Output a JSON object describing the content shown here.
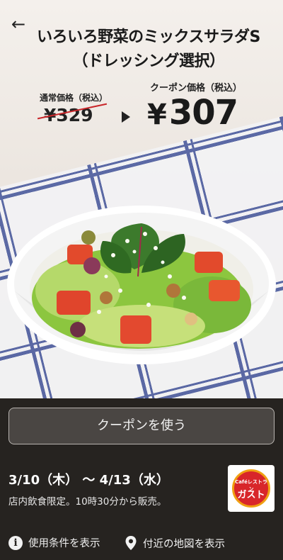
{
  "header": {
    "back_icon": "arrow-left-icon",
    "title": "いろいろ野菜のミックスサラダS\n（ドレッシング選択）"
  },
  "price": {
    "regular_label": "通常価格（税込）",
    "regular_value": "¥329",
    "coupon_label": "クーポン価格（税込）",
    "coupon_yen": "¥",
    "coupon_value": "307"
  },
  "actions": {
    "use_coupon": "クーポンを使う"
  },
  "validity": {
    "period": "3/10（木） 〜 4/13（水）",
    "note": "店内飲食限定。10時30分から販売。"
  },
  "brand": {
    "logo_small": "Caféレストラン",
    "logo_main": "ガスト"
  },
  "footer": {
    "terms": "使用条件を表示",
    "map": "付近の地図を表示"
  },
  "colors": {
    "panel": "#262320",
    "strike": "#c9262a",
    "logo_red": "#d8262a"
  }
}
